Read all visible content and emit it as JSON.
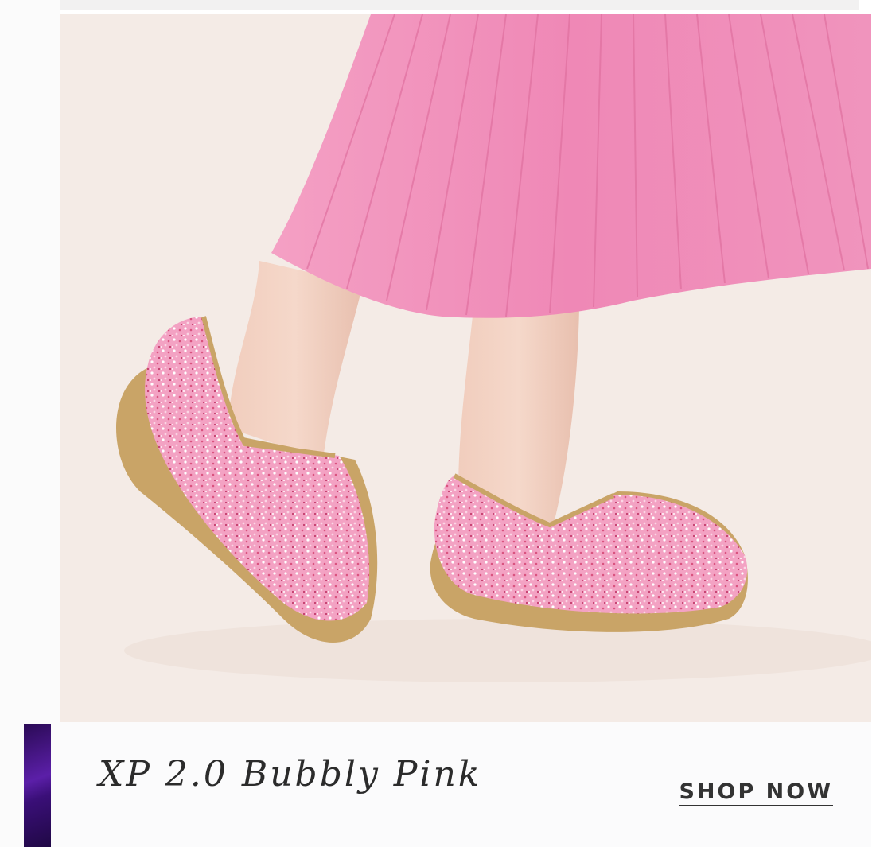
{
  "promo": {
    "product_name": "XP 2.0 Bubbly Pink",
    "cta_label": "SHOP NOW",
    "photo_description": "pink glitter clogs with pleated pink skirt"
  },
  "colors": {
    "photo_background": "#f4ebe6",
    "skirt": "#f08bb8",
    "clog_upper": "#f2a3c3",
    "clog_sole": "#c9a467",
    "caption_background": "#fbfbfc",
    "text": "#2b2b2b",
    "side_thumbnail": "#4a1690"
  }
}
